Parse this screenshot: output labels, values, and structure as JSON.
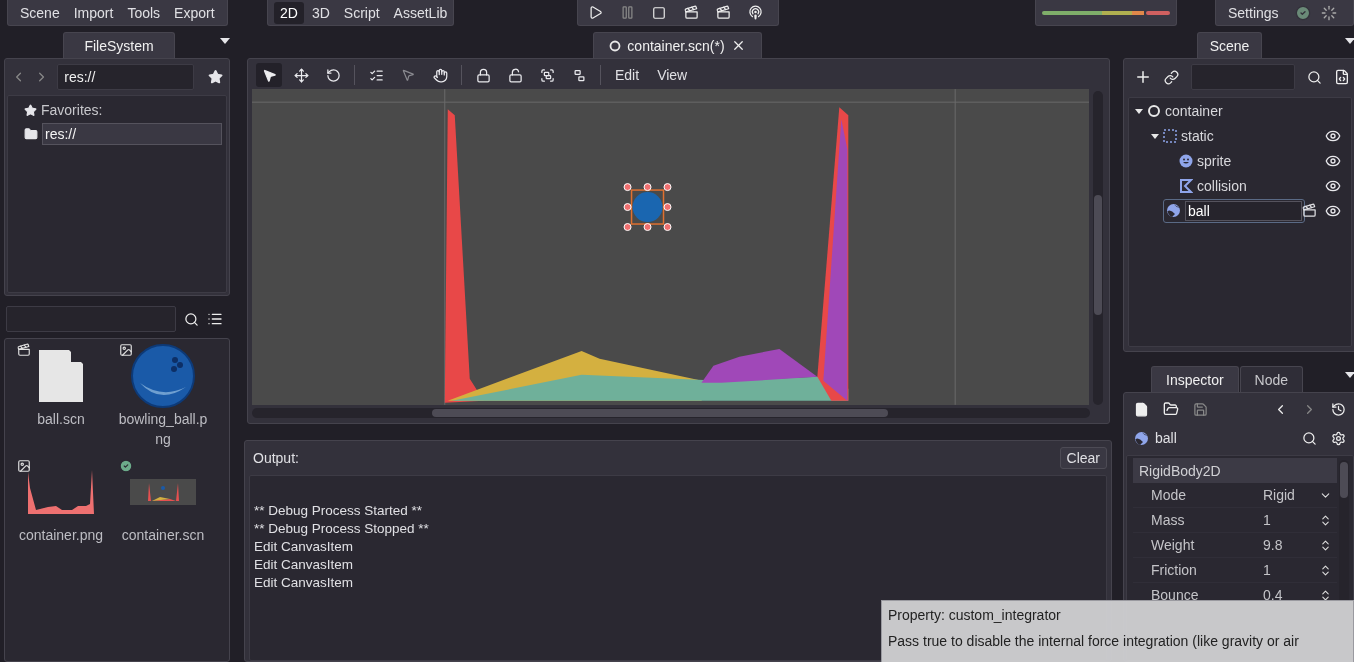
{
  "menu": [
    "Scene",
    "Import",
    "Tools",
    "Export"
  ],
  "workspaces": [
    {
      "label": "2D",
      "selected": true
    },
    {
      "label": "3D",
      "selected": false
    },
    {
      "label": "Script",
      "selected": false
    },
    {
      "label": "AssetLib",
      "selected": false
    }
  ],
  "settings": {
    "label": "Settings"
  },
  "filesystem": {
    "tab": "FileSystem",
    "path": "res://",
    "favorites_label": "Favorites:",
    "favorites": [
      "res://"
    ],
    "files": [
      {
        "name": "ball.scn",
        "kind": "scene"
      },
      {
        "name": "bowling_ball.png",
        "kind": "ball_image"
      },
      {
        "name": "container.png",
        "kind": "chart_image"
      },
      {
        "name": "container.scn",
        "kind": "scene_preview"
      }
    ]
  },
  "editor_tab": {
    "title": "container.scn(*)"
  },
  "viewport_menu": [
    "Edit",
    "View"
  ],
  "output": {
    "title": "Output:",
    "clear": "Clear",
    "lines": [
      "** Debug Process Started **",
      "** Debug Process Stopped **",
      "Edit CanvasItem",
      "Edit CanvasItem",
      "Edit CanvasItem"
    ]
  },
  "scene_dock": {
    "tab": "Scene",
    "tree": [
      {
        "name": "container",
        "kind": "root",
        "expanded": true,
        "selected": false,
        "children": [
          {
            "name": "static",
            "kind": "static",
            "expanded": true,
            "visible": true,
            "selected": false,
            "children": [
              {
                "name": "sprite",
                "kind": "sprite",
                "visible": true,
                "selected": false
              },
              {
                "name": "collision",
                "kind": "collision",
                "visible": true,
                "selected": false
              }
            ]
          },
          {
            "name": "ball",
            "kind": "rigid",
            "visible": true,
            "selected": true
          }
        ]
      }
    ]
  },
  "inspector": {
    "tabs": [
      {
        "label": "Inspector",
        "selected": true
      },
      {
        "label": "Node",
        "selected": false
      }
    ],
    "object": "ball",
    "section": "RigidBody2D",
    "properties": [
      {
        "name": "Mode",
        "value": "Rigid",
        "kind": "enum"
      },
      {
        "name": "Mass",
        "value": "1",
        "kind": "number"
      },
      {
        "name": "Weight",
        "value": "9.8",
        "kind": "number"
      },
      {
        "name": "Friction",
        "value": "1",
        "kind": "number"
      },
      {
        "name": "Bounce",
        "value": "0.4",
        "kind": "number"
      }
    ]
  },
  "tooltip": {
    "title": "Property: custom_integrator",
    "text": "Pass true to disable the internal force integration (like gravity or air"
  }
}
